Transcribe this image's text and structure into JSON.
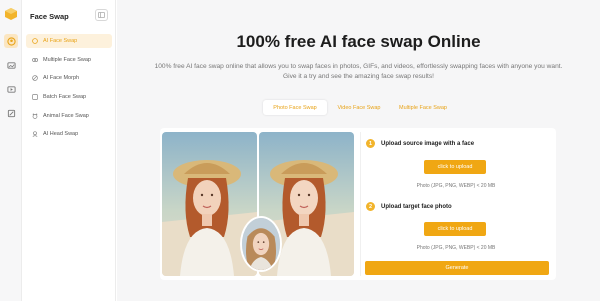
{
  "app": {
    "title": "Face Swap"
  },
  "sidebar": {
    "items": [
      {
        "label": "AI Face Swap",
        "icon": "face-swap-icon",
        "active": true
      },
      {
        "label": "Multiple Face Swap",
        "icon": "multi-face-icon",
        "active": false
      },
      {
        "label": "AI Face Morph",
        "icon": "morph-icon",
        "active": false
      },
      {
        "label": "Batch Face Swap",
        "icon": "batch-icon",
        "active": false
      },
      {
        "label": "Animal Face Swap",
        "icon": "animal-icon",
        "active": false
      },
      {
        "label": "AI Head Swap",
        "icon": "head-swap-icon",
        "active": false
      }
    ]
  },
  "rail": {
    "icons": [
      "face-swap-icon",
      "image-icon",
      "video-icon",
      "edit-icon"
    ]
  },
  "hero": {
    "title": "100% free AI face swap Online",
    "description": "100% free AI face swap online that allows you to swap faces in photos, GIFs, and videos, effortlessly swapping faces with anyone you want. Give it a try and see the amazing face swap results!"
  },
  "tabs": [
    {
      "label": "Photo Face Swap",
      "active": true
    },
    {
      "label": "Video Face Swap",
      "active": false
    },
    {
      "label": "Multiple Face Swap",
      "active": false
    }
  ],
  "steps": [
    {
      "number": "1",
      "title": "Upload source image with a face",
      "button": "click to upload",
      "hint": "Photo (JPG, PNG, WEBP) < 20 MB"
    },
    {
      "number": "2",
      "title": "Upload target face photo",
      "button": "click to upload",
      "hint": "Photo (JPG, PNG, WEBP) < 20 MB"
    }
  ],
  "generate": {
    "label": "Generate"
  },
  "colors": {
    "accent": "#f0a713",
    "accent_light": "#fdf1dc"
  }
}
